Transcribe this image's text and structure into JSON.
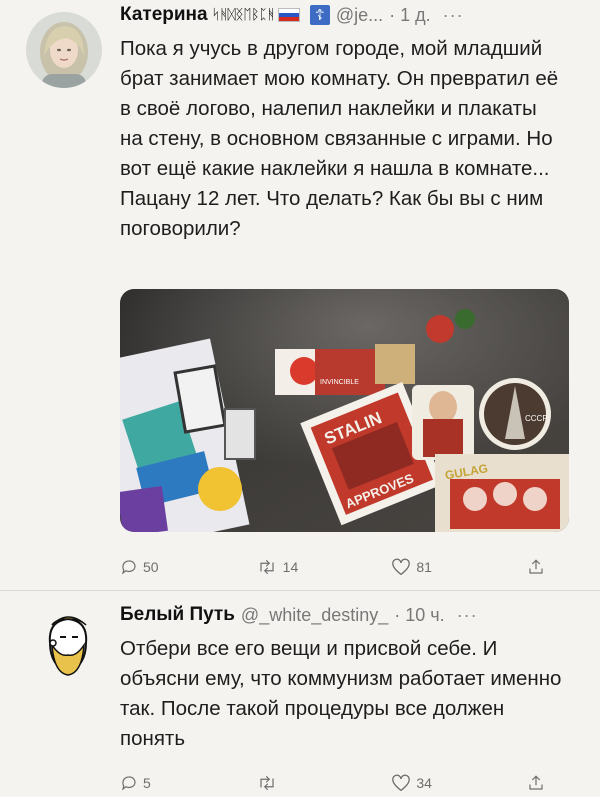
{
  "tweets": [
    {
      "name": "Катерина",
      "name_decoration": "ᛋᚻᛞᛝᛖᛒᛈᚻ",
      "handle": "@je...",
      "time": "· 1 д.",
      "text": "Пока я учусь в другом городе, мой младший брат занимает мою комнату. Он превратил её в своё логово, налепил наклейки и плакаты на стену, в основном связанные с играми. Но вот ещё какие наклейки я нашла в комнате... Пацану 12 лет. Что делать? Как бы вы с ним поговорили?",
      "media": {
        "stickers": [
          "STALIN",
          "APPROVES",
          "GULAG",
          "СССР",
          "INVINCIBLE"
        ]
      },
      "replies": "50",
      "retweets": "14",
      "likes": "81"
    },
    {
      "name": "Белый Путь",
      "handle": "@_white_destiny_",
      "time": "· 10 ч.",
      "text": "Отбери все его вещи и присвой себе. И объясни ему, что коммунизм работает именно так. После такой процедуры все должен понять",
      "replies": "5",
      "retweets": "",
      "likes": "34"
    }
  ],
  "icons": {
    "reply": "speech-bubble-icon",
    "retweet": "retweet-arrows-icon",
    "like": "heart-icon",
    "share": "share-arrow-icon",
    "more": "ellipsis-icon"
  },
  "colors": {
    "background": "#f4f3ef",
    "text": "#1e1e1e",
    "muted": "#6e6e6e"
  }
}
